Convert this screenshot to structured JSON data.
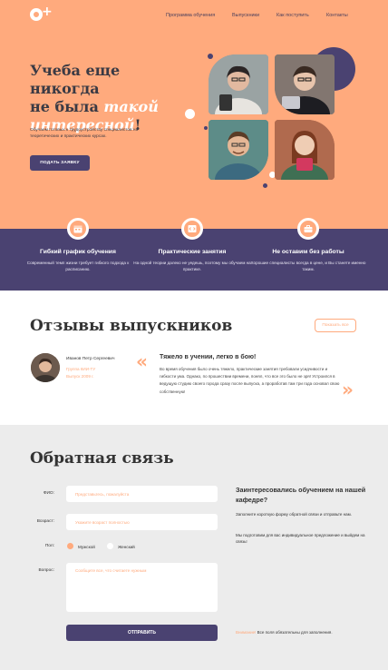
{
  "nav": {
    "items": [
      "Программа обучения",
      "Выпускники",
      "Как поступить",
      "Контакты"
    ]
  },
  "hero": {
    "title_line1": "Учеба еще никогда",
    "title_line2_plain": "не была ",
    "title_line2_accent": "такой",
    "title_line3_accent": "интересной",
    "title_line3_tail": "!",
    "subtitle": "Обучаем готовых к трудоустройству специалистов на теоретических и практических курсах.",
    "button": "ПОДАТЬ ЗАЯВКУ"
  },
  "features": [
    {
      "icon": "calendar-icon",
      "title": "Гибкий график обучения",
      "text": "Современный темп жизни требует гибкого подхода к расписанию."
    },
    {
      "icon": "code-icon",
      "title": "Практические занятия",
      "text": "На одной теории далеко не уедешь, поэтому мы обучаем на практике."
    },
    {
      "icon": "briefcase-icon",
      "title": "Не оставим без работы",
      "text": "Хорошие специалисты всегда в цене, и Вы станете именно таким."
    }
  ],
  "reviews": {
    "title": "Отзывы выпускников",
    "show_all": "Показать все",
    "name": "Иванов Петр Сергеевич",
    "group": "Группа 6ИИ-ТУ",
    "year": "Выпуск 2009 г.",
    "headline": "Тяжело в учении, легко в бою!",
    "text": "Во время обучения было очень тяжело, практические занятия требовали усидчивости и гибкости ума. Однако, по прошествии времени, понял, что все это было не зря! Устроился в ведущую студию своего города сразу после выпуска, а проработав там три года основал свою собственную!"
  },
  "feedback": {
    "title": "Обратная связь",
    "fio_label": "ФИО:",
    "fio_placeholder": "Представьтесь, пожалуйста",
    "age_label": "Возраст:",
    "age_placeholder": "Укажите возраст полностью",
    "sex_label": "Пол:",
    "sex_male": "Мужской",
    "sex_female": "Женский",
    "question_label": "Вопрос:",
    "question_placeholder": "Сообщите все, что считаете нужным",
    "submit": "ОТПРАВИТЬ",
    "side_title": "Заинтересовались обучением на нашей кафедре?",
    "side_p1": "Заполните короткую форму обратной связи и отправьте нам.",
    "side_p2": "Мы подготовим для вас индивидуальное предложение и выйдем на связь!",
    "note_warn": "Внимание!",
    "note_text": " Все поля обязательны для заполнения."
  },
  "colors": {
    "accent": "#ffaa7d",
    "primary": "#4a4271",
    "bg_grey": "#ececec"
  }
}
